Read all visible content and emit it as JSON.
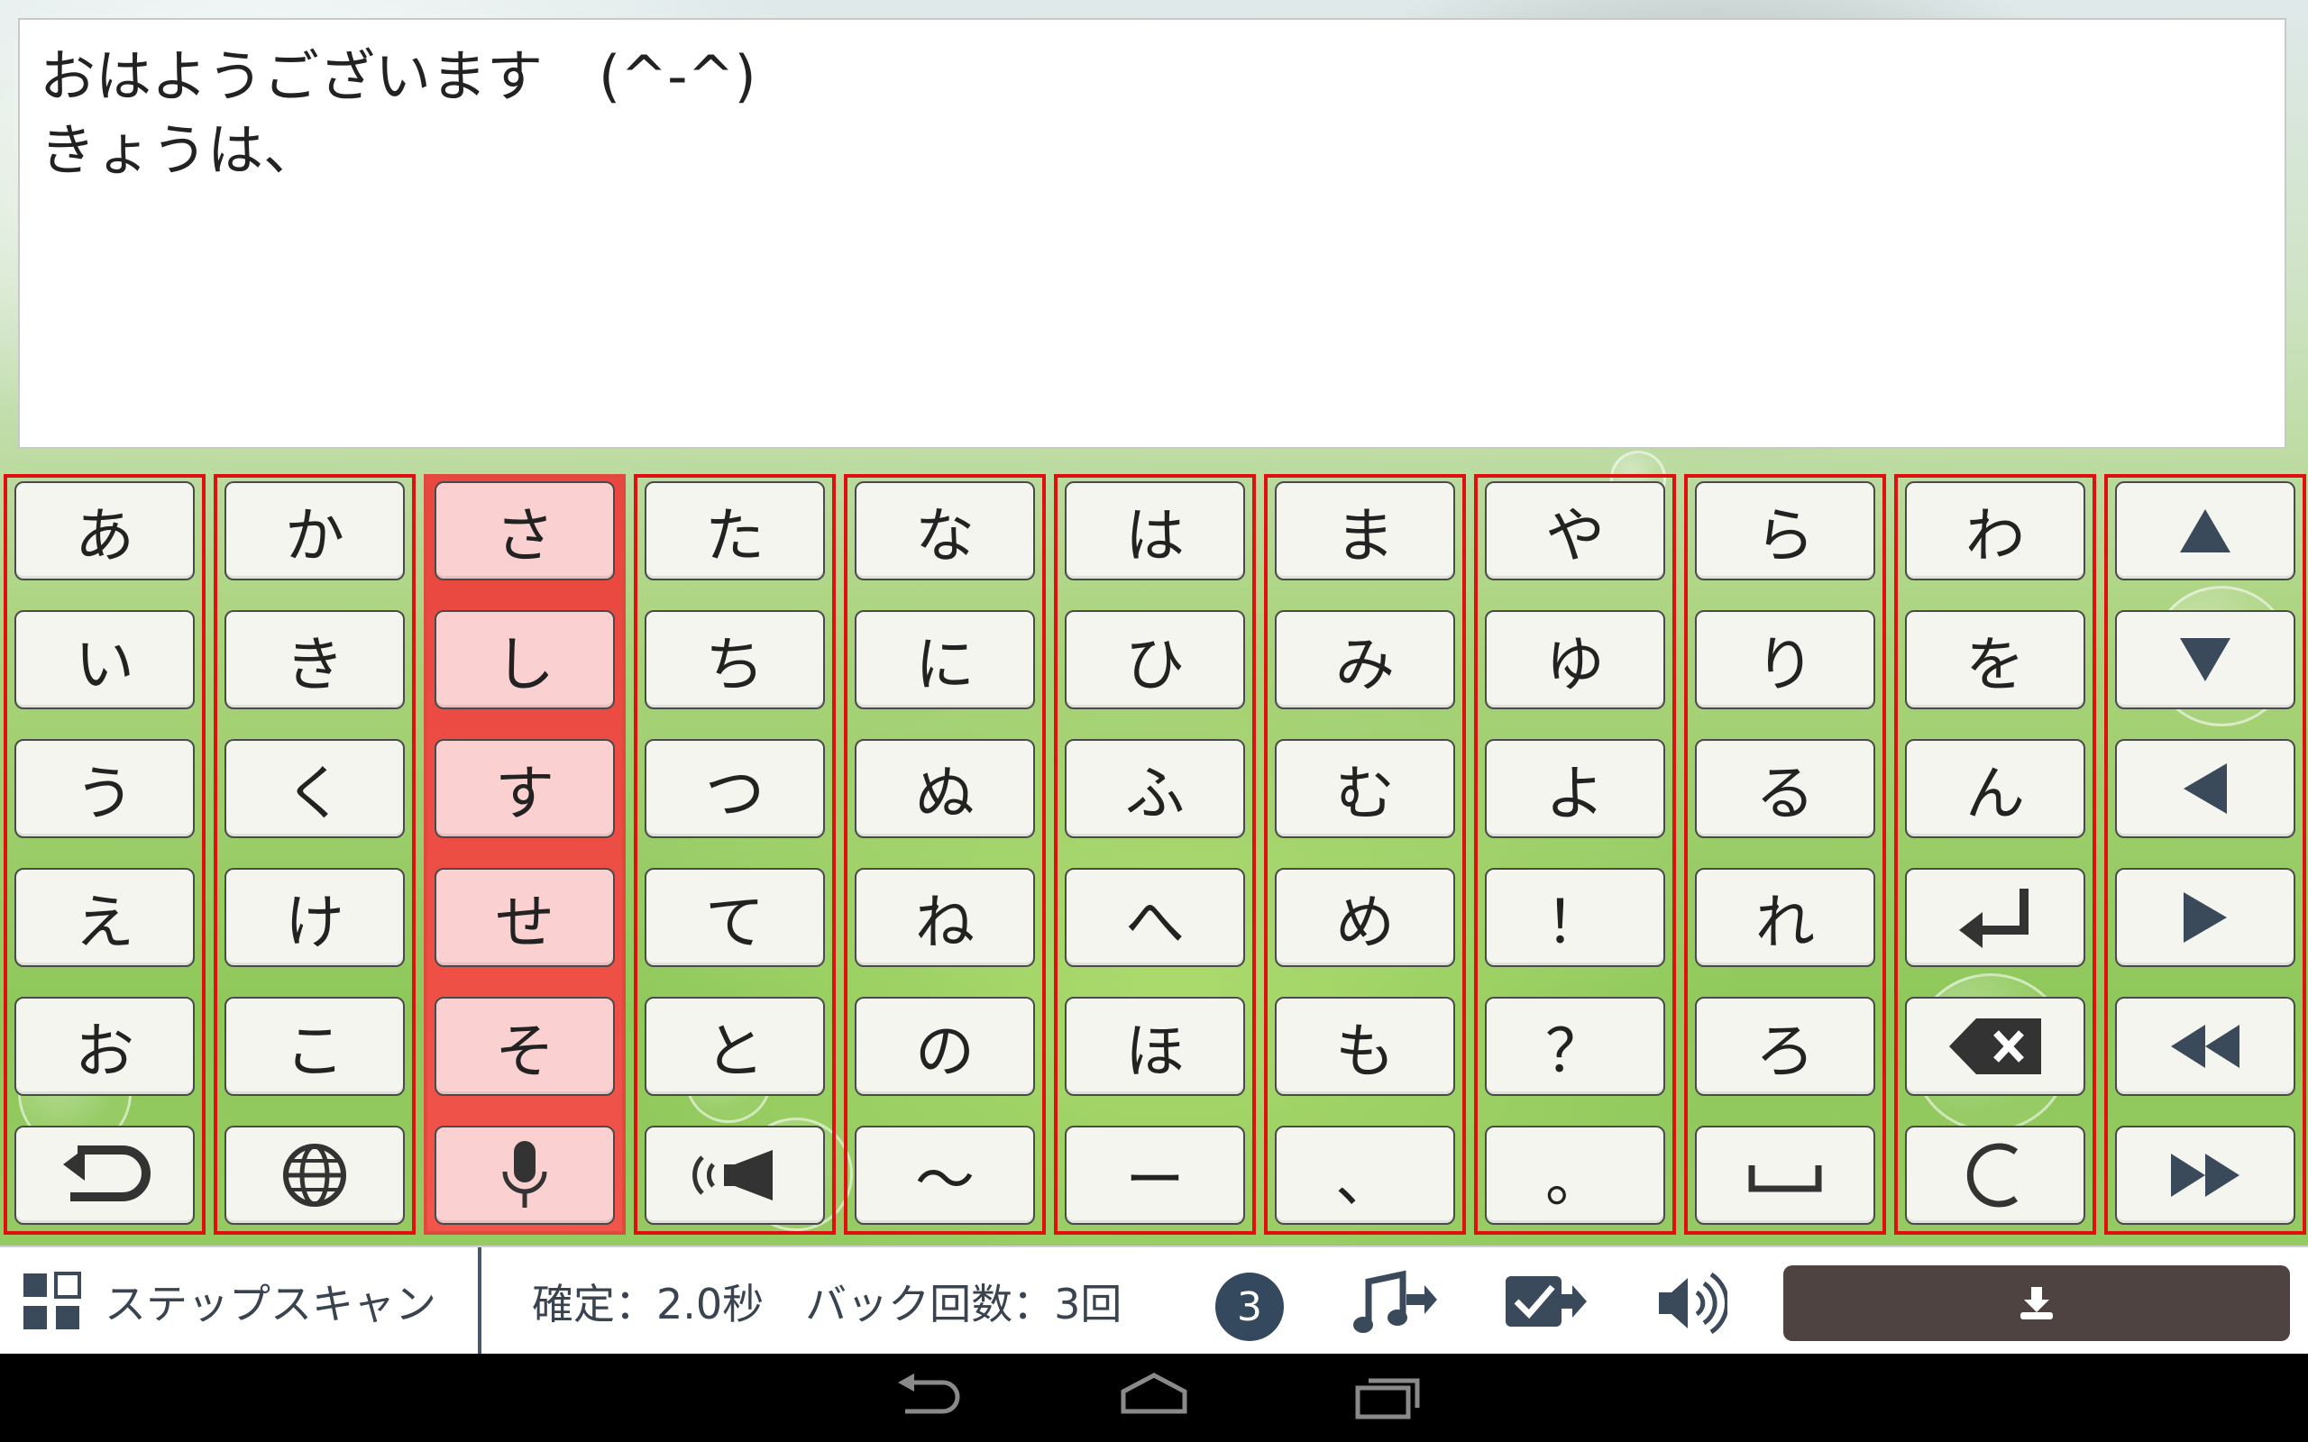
{
  "text_area": {
    "lines": [
      "おはようございます　(^-^)",
      "きょうは、"
    ]
  },
  "keyboard": {
    "active_column": 2,
    "columns": [
      {
        "keys": [
          "あ",
          "い",
          "う",
          "え",
          "お",
          "return-icon"
        ]
      },
      {
        "keys": [
          "か",
          "き",
          "く",
          "け",
          "こ",
          "globe-icon"
        ]
      },
      {
        "keys": [
          "さ",
          "し",
          "す",
          "せ",
          "そ",
          "microphone-icon"
        ]
      },
      {
        "keys": [
          "た",
          "ち",
          "つ",
          "て",
          "と",
          "speaker-play-icon"
        ]
      },
      {
        "keys": [
          "な",
          "に",
          "ぬ",
          "ね",
          "の",
          "〜"
        ]
      },
      {
        "keys": [
          "は",
          "ひ",
          "ふ",
          "へ",
          "ほ",
          "ー"
        ]
      },
      {
        "keys": [
          "ま",
          "み",
          "む",
          "め",
          "も",
          "、"
        ]
      },
      {
        "keys": [
          "や",
          "ゆ",
          "よ",
          "！",
          "？",
          "。"
        ]
      },
      {
        "keys": [
          "ら",
          "り",
          "る",
          "れ",
          "ろ",
          "space-icon"
        ]
      },
      {
        "keys": [
          "わ",
          "を",
          "ん",
          "enter-icon",
          "backspace-icon",
          "clear-icon"
        ]
      },
      {
        "keys": [
          "up-arrow-icon",
          "down-arrow-icon",
          "left-arrow-icon",
          "right-arrow-icon",
          "rewind-icon",
          "fast-forward-icon"
        ]
      }
    ],
    "col0": {
      "k0": "あ",
      "k1": "い",
      "k2": "う",
      "k3": "え",
      "k4": "お"
    },
    "col1": {
      "k0": "か",
      "k1": "き",
      "k2": "く",
      "k3": "け",
      "k4": "こ"
    },
    "col2": {
      "k0": "さ",
      "k1": "し",
      "k2": "す",
      "k3": "せ",
      "k4": "そ"
    },
    "col3": {
      "k0": "た",
      "k1": "ち",
      "k2": "つ",
      "k3": "て",
      "k4": "と"
    },
    "col4": {
      "k0": "な",
      "k1": "に",
      "k2": "ぬ",
      "k3": "ね",
      "k4": "の",
      "k5": "〜"
    },
    "col5": {
      "k0": "は",
      "k1": "ひ",
      "k2": "ふ",
      "k3": "へ",
      "k4": "ほ",
      "k5": "ー"
    },
    "col6": {
      "k0": "ま",
      "k1": "み",
      "k2": "む",
      "k3": "め",
      "k4": "も",
      "k5": "、"
    },
    "col7": {
      "k0": "や",
      "k1": "ゆ",
      "k2": "よ",
      "k3": "！",
      "k4": "？",
      "k5": "。"
    },
    "col8": {
      "k0": "ら",
      "k1": "り",
      "k2": "る",
      "k3": "れ",
      "k4": "ろ"
    },
    "col9": {
      "k0": "わ",
      "k1": "を",
      "k2": "ん"
    }
  },
  "bottom_bar": {
    "scan_mode_label": "ステップスキャン",
    "status_text": "確定：2.0秒　バック回数：3回",
    "count_badge": "3",
    "icons": [
      "grid-scan-icon",
      "music-forward-icon",
      "check-forward-icon",
      "volume-icon",
      "download-icon"
    ]
  },
  "colors": {
    "active_column": "#e9473f",
    "column_border": "#e01010",
    "key_background": "#f4f5ee",
    "active_key_background": "#fbd0d0",
    "badge": "#34495e",
    "download_button": "#4e4341"
  },
  "nav_bar": {
    "icons": [
      "back-icon",
      "home-icon",
      "recent-apps-icon"
    ]
  }
}
